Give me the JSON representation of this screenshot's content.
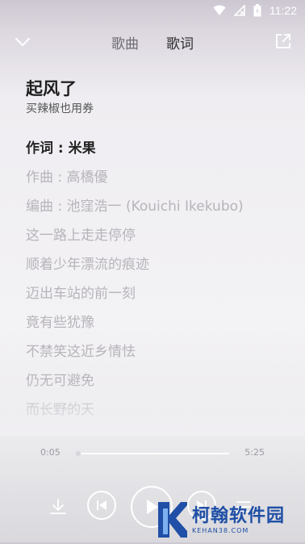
{
  "status": {
    "time": "11:22"
  },
  "nav": {
    "tabs": [
      {
        "label": "歌曲",
        "active": false
      },
      {
        "label": "歌词",
        "active": true
      }
    ]
  },
  "song": {
    "title": "起风了",
    "artist": "买辣椒也用券"
  },
  "lyrics": [
    "作词 : 米果",
    "作曲 : 高橋優",
    "编曲 : 池窪浩一 (Kouichi Ikekubo)",
    "这一路上走走停停",
    "顺着少年漂流的痕迹",
    "迈出车站的前一刻",
    "竟有些犹豫",
    "不禁笑这近乡情怯",
    "仍无可避免",
    "而长野的天"
  ],
  "current_lyric_index": 0,
  "player": {
    "current_time": "0:05",
    "total_time": "5:25",
    "progress_fraction": 0.016
  },
  "watermark": {
    "name": "柯翰软件园",
    "url": "KEHAN38.COM"
  },
  "colors": {
    "accent": "#1f4fa6",
    "lyric_active": "#232323",
    "lyric_inactive": "#b7b4bb"
  }
}
